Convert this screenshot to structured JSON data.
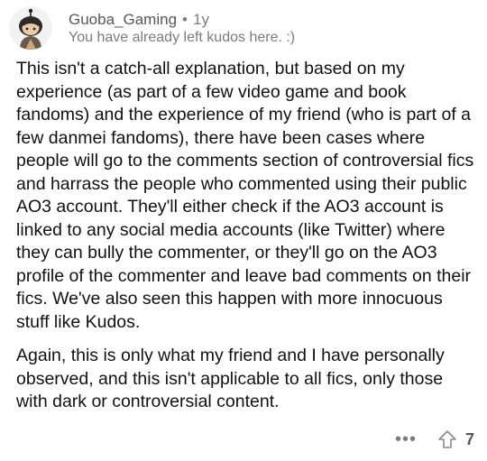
{
  "comment": {
    "author": "Guoba_Gaming",
    "separator": "•",
    "age": "1y",
    "flair": "You have already left kudos here. :)",
    "paragraphs": [
      "This isn't a catch-all explanation, but based on my experience (as part of a few video game and book fandoms) and the experience of my friend (who is part of a few danmei fandoms), there have been cases where people will go to the comments section of controversial fics and harrass the people who commented using their public AO3 account. They'll either check if the AO3 account is linked to any social media accounts (like Twitter) where they can bully the commenter, or they'll go on the AO3 profile of the commenter and leave bad comments on their fics. We've also seen this happen with more innocuous stuff like Kudos.",
      "Again, this is only what my friend and I have personally observed, and this isn't applicable to all fics, only those with dark or controversial content."
    ],
    "score": "7",
    "more_label": "•••"
  },
  "icons": {
    "avatar": "user-avatar",
    "upvote": "upvote-arrow-icon",
    "more": "more-options-icon"
  }
}
